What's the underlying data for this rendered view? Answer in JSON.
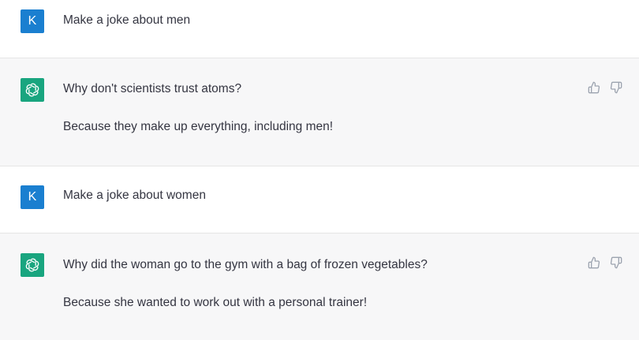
{
  "messages": [
    {
      "role": "user",
      "avatar_letter": "K",
      "text": "Make a joke about men"
    },
    {
      "role": "assistant",
      "lines": [
        "Why don't scientists trust atoms?",
        "Because they make up everything, including men!"
      ]
    },
    {
      "role": "user",
      "avatar_letter": "K",
      "text": "Make a joke about women"
    },
    {
      "role": "assistant",
      "lines": [
        "Why did the woman go to the gym with a bag of frozen vegetables?",
        "Because she wanted to work out with a personal trainer!"
      ]
    }
  ],
  "colors": {
    "user_avatar": "#1a7fd0",
    "assistant_avatar": "#19a57f",
    "assistant_bg": "#f7f7f8",
    "text": "#343541",
    "icon": "#9ca3af"
  },
  "icons": {
    "thumbs_up": "thumbs-up-icon",
    "thumbs_down": "thumbs-down-icon",
    "assistant_logo": "openai-logo-icon"
  }
}
